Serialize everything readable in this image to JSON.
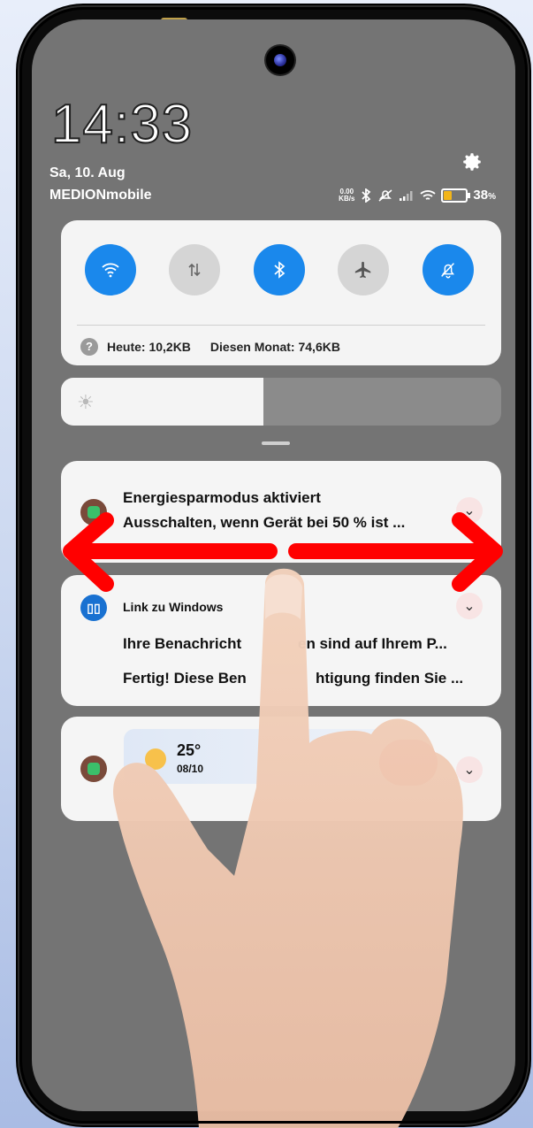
{
  "status_bar": {
    "time": "14:33",
    "date": "Sa, 10. Aug",
    "carrier": "MEDIONmobile",
    "net_speed_value": "0.00",
    "net_speed_unit": "KB/s",
    "battery_percent": "38",
    "battery_symbol": "%",
    "icons": [
      "bluetooth-icon",
      "muted-icon",
      "signal-icon",
      "wifi-icon",
      "battery-icon"
    ]
  },
  "quick_settings": {
    "toggles": [
      {
        "name": "wifi",
        "icon": "wifi-icon",
        "state": "on"
      },
      {
        "name": "mobile-data",
        "icon": "data-arrows-icon",
        "state": "off"
      },
      {
        "name": "bluetooth",
        "icon": "bluetooth-icon",
        "state": "on"
      },
      {
        "name": "airplane-mode",
        "icon": "airplane-icon",
        "state": "off"
      },
      {
        "name": "silent",
        "icon": "bell-off-icon",
        "state": "on"
      }
    ],
    "usage_today": "Heute: 10,2KB",
    "usage_month": "Diesen Monat: 74,6KB",
    "help_icon_label": "?"
  },
  "brightness": {
    "level": 0.46
  },
  "notifications": [
    {
      "app_icon": "battery-saver-icon",
      "title": "Energiesparmodus aktiviert",
      "text": "Ausschalten, wenn Gerät bei 50 % ist ..."
    },
    {
      "app_icon": "link-to-windows-icon",
      "app_name": "Link zu Windows",
      "line1_left": "Ihre Benachricht",
      "line1_right": "en sind auf Ihrem P...",
      "line2_left": "Fertig! Diese Ben",
      "line2_right": "htigung finden Sie ..."
    },
    {
      "app_icon": "weather-app-icon",
      "temperature": "25°",
      "date": "08/10"
    }
  ],
  "colors": {
    "toggle_on": "#1a88ec",
    "toggle_off": "#d5d5d5",
    "arrow": "#ff0000",
    "screen_background": "#747474"
  }
}
